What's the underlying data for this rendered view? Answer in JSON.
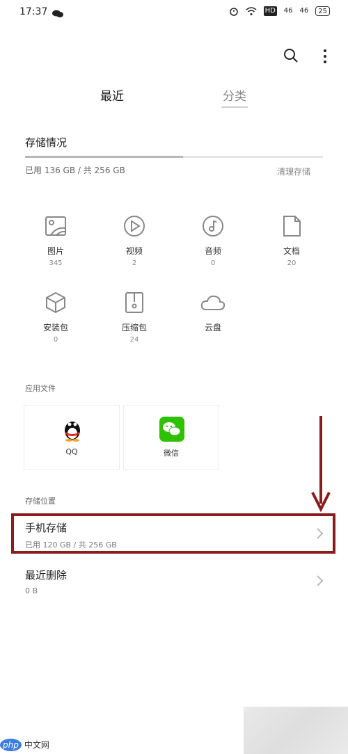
{
  "status_bar": {
    "time": "17:37",
    "signal1": "46",
    "signal2": "46",
    "hd_label": "HD",
    "battery": "25"
  },
  "toolbar": {
    "search_icon": "search-icon",
    "more_icon": "more-vertical-icon"
  },
  "tabs": [
    {
      "label": "最近",
      "active": false
    },
    {
      "label": "分类",
      "active": true
    }
  ],
  "storage": {
    "title": "存储情况",
    "usage": "已用 136 GB / 共 256 GB",
    "used_fraction": 0.53,
    "clean_label": "清理存储"
  },
  "categories": [
    {
      "label": "图片",
      "count": "345",
      "icon": "image-icon"
    },
    {
      "label": "视频",
      "count": "2",
      "icon": "video-play-icon"
    },
    {
      "label": "音频",
      "count": "0",
      "icon": "music-note-icon"
    },
    {
      "label": "文档",
      "count": "20",
      "icon": "document-icon"
    },
    {
      "label": "安装包",
      "count": "0",
      "icon": "package-cube-icon"
    },
    {
      "label": "压缩包",
      "count": "24",
      "icon": "zip-file-icon"
    },
    {
      "label": "云盘",
      "count": "",
      "icon": "cloud-icon"
    }
  ],
  "app_files": {
    "title": "应用文件",
    "apps": [
      {
        "label": "QQ",
        "icon": "qq-penguin-icon"
      },
      {
        "label": "微信",
        "icon": "wechat-icon"
      }
    ]
  },
  "locations": {
    "title": "存储位置",
    "items": [
      {
        "title": "手机存储",
        "sub": "已用 120 GB / 共 256 GB"
      },
      {
        "title": "最近删除",
        "sub": "0 B"
      }
    ]
  },
  "colors": {
    "highlight": "#8b1c1c",
    "wechat_green": "#2dc100"
  },
  "footer": {
    "logo_php": "php",
    "logo_cn": "中文网"
  }
}
